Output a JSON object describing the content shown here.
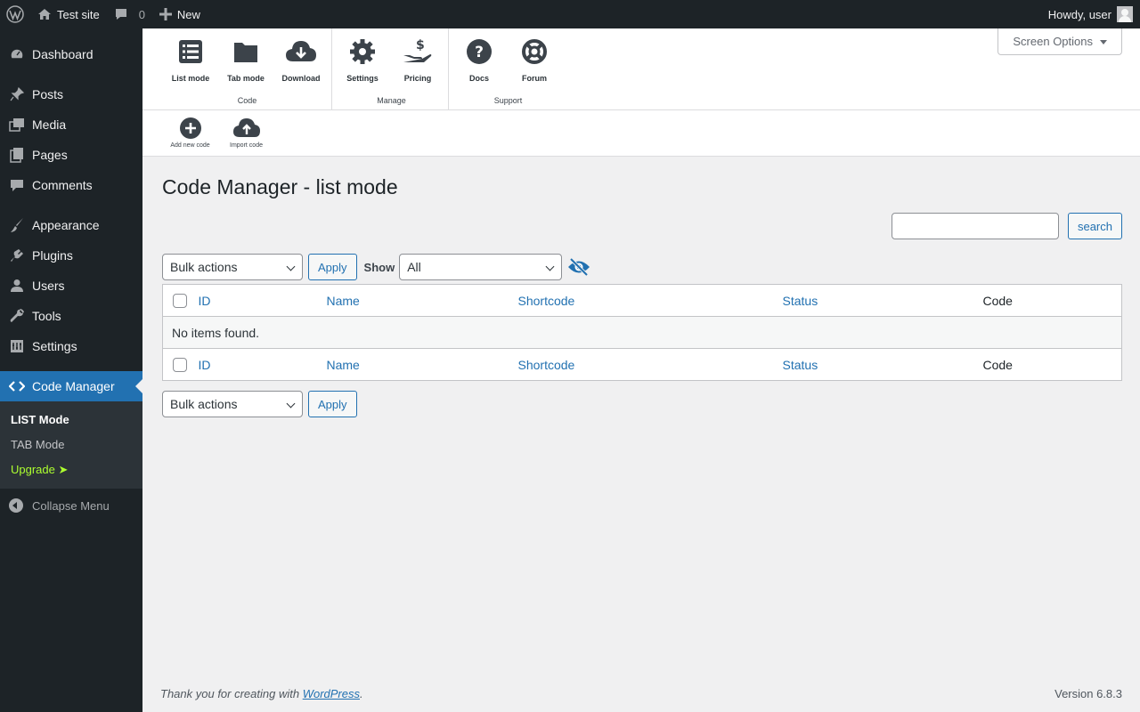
{
  "adminbar": {
    "site_name": "Test site",
    "comments_count": "0",
    "new_label": "New",
    "howdy": "Howdy, user"
  },
  "sidebar": {
    "items": [
      {
        "label": "Dashboard",
        "icon": "dashboard-icon"
      },
      {
        "label": "Posts",
        "icon": "pin-icon"
      },
      {
        "label": "Media",
        "icon": "media-icon"
      },
      {
        "label": "Pages",
        "icon": "pages-icon"
      },
      {
        "label": "Comments",
        "icon": "comment-icon"
      },
      {
        "label": "Appearance",
        "icon": "brush-icon"
      },
      {
        "label": "Plugins",
        "icon": "plugin-icon"
      },
      {
        "label": "Users",
        "icon": "user-icon"
      },
      {
        "label": "Tools",
        "icon": "wrench-icon"
      },
      {
        "label": "Settings",
        "icon": "settings-icon"
      },
      {
        "label": "Code Manager",
        "icon": "code-icon"
      }
    ],
    "submenu": [
      {
        "label": "LIST Mode"
      },
      {
        "label": "TAB Mode"
      },
      {
        "label": "Upgrade ➤"
      }
    ],
    "collapse_label": "Collapse Menu"
  },
  "toolbar": {
    "groups": [
      {
        "name": "Code",
        "buttons": [
          {
            "label": "List mode"
          },
          {
            "label": "Tab mode"
          },
          {
            "label": "Download"
          }
        ]
      },
      {
        "name": "Manage",
        "buttons": [
          {
            "label": "Settings"
          },
          {
            "label": "Pricing"
          }
        ]
      },
      {
        "name": "Support",
        "buttons": [
          {
            "label": "Docs"
          },
          {
            "label": "Forum"
          }
        ]
      }
    ],
    "row2": [
      {
        "label": "Add new code"
      },
      {
        "label": "Import code"
      }
    ],
    "screen_options": "Screen Options"
  },
  "main": {
    "title": "Code Manager - list mode",
    "search_button": "search",
    "search_value": "",
    "bulk_actions": "Bulk actions",
    "apply": "Apply",
    "show_label": "Show",
    "show_value": "All",
    "columns": [
      "ID",
      "Name",
      "Shortcode",
      "Status",
      "Code"
    ],
    "no_items": "No items found."
  },
  "footer": {
    "thanks_prefix": "Thank you for creating with ",
    "thanks_link": "WordPress",
    "thanks_suffix": ".",
    "version": "Version 6.8.3"
  },
  "colors": {
    "accent": "#2271b1",
    "sidebar_bg": "#1d2327",
    "upgrade": "#adff2f"
  }
}
